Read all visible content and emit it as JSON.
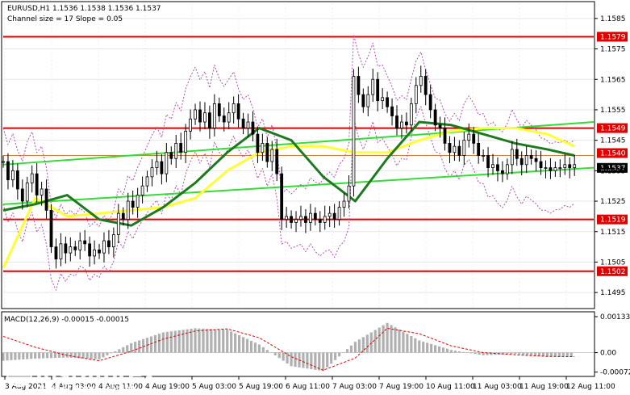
{
  "header": {
    "symbol_line": "EURUSD,H1  1.1536 1.1538 1.1536 1.1537",
    "channel_line": "Channel size = 17 Slope = 0.05",
    "macd_label": "MACD(12,26,9) -0.00015 -0.00015"
  },
  "logo": {
    "name": "instaforex",
    "tagline": "Instant Forex Trading"
  },
  "colors": {
    "candle": "#000000",
    "ma_fast": "#ffff33",
    "ma_slow": "#1e7a1e",
    "channel": "#33dd33",
    "bands": "#b050b0",
    "level_line": "#e00000",
    "macd_hist": "#b0b0b0",
    "macd_signal": "#e00000",
    "tag_current": "#000000",
    "tag_level": "#e00000"
  },
  "chart_data": [
    {
      "type": "line",
      "title": "EURUSD,H1",
      "ylim": [
        1.149,
        1.159
      ],
      "y_ticks": [
        1.1495,
        1.1505,
        1.1515,
        1.1525,
        1.1535,
        1.1545,
        1.1555,
        1.1565,
        1.1575,
        1.1585
      ],
      "x_ticks": [
        "3 Aug 2021",
        "4 Aug 03:00",
        "4 Aug 11:00",
        "4 Aug 19:00",
        "5 Aug 03:00",
        "5 Aug 19:00",
        "6 Aug 11:00",
        "7 Aug 03:00",
        "7 Aug 19:00",
        "10 Aug 11:00",
        "11 Aug 03:00",
        "11 Aug 19:00",
        "12 Aug 11:00"
      ],
      "x_tick_labels": [
        "3 Aug 2021",
        "4 Aug 03:00",
        "4 Aug 11:00",
        "4 Aug 19:00",
        "5 Aug 03:00",
        "5 Aug 19:00",
        "6 Aug 11:00",
        "7 Aug 03:00",
        "7 Aug 19:00",
        "10 Aug 11:00",
        "11 Aug 03:00",
        "11 Aug 19:00",
        "12 Aug 11:00"
      ],
      "horizontal_levels": [
        {
          "label": "1.1579",
          "value": 1.1579
        },
        {
          "label": "1.1549",
          "value": 1.1549
        },
        {
          "label": "1.1519",
          "value": 1.1519
        },
        {
          "label": "1.1502",
          "value": 1.1502
        }
      ],
      "price_tags": [
        {
          "label": "1.1540",
          "value": 1.154,
          "kind": "level"
        },
        {
          "label": "1.1537",
          "value": 1.1537,
          "kind": "current"
        }
      ],
      "series": [
        {
          "name": "EURUSD",
          "x": [
            0,
            6,
            12,
            18,
            24,
            30,
            36,
            42,
            48,
            54,
            60,
            66,
            72,
            78,
            84,
            90,
            96,
            102,
            108,
            114,
            120,
            126,
            132,
            138,
            144,
            150,
            156,
            162,
            168,
            174,
            180,
            186,
            192,
            198,
            204,
            210,
            216,
            222,
            228,
            234,
            240,
            246,
            252,
            258,
            264,
            270,
            276,
            282,
            288,
            294,
            300,
            306,
            312,
            318,
            324,
            330,
            336,
            342,
            348,
            354,
            360,
            366,
            372,
            378,
            384,
            390,
            396,
            402,
            408,
            414,
            420,
            426,
            432,
            438,
            444,
            450,
            456,
            462,
            468,
            474,
            480,
            486,
            492,
            498,
            504,
            510,
            516,
            522,
            528,
            534,
            540,
            546,
            552,
            558,
            564,
            570,
            576,
            582,
            588,
            594,
            600,
            606,
            612,
            618,
            624,
            630,
            636,
            642,
            648,
            654,
            660,
            666,
            672,
            678,
            684,
            690,
            696,
            702,
            708,
            714
          ],
          "values": [
            1.1538,
            1.1532,
            1.1535,
            1.1529,
            1.1525,
            1.1531,
            1.1534,
            1.1527,
            1.1529,
            1.1522,
            1.151,
            1.1506,
            1.1511,
            1.1508,
            1.151,
            1.1509,
            1.1512,
            1.1511,
            1.1507,
            1.1509,
            1.1508,
            1.1512,
            1.151,
            1.1514,
            1.1521,
            1.1519,
            1.1525,
            1.1523,
            1.1527,
            1.153,
            1.1533,
            1.1536,
            1.1538,
            1.1534,
            1.1541,
            1.1539,
            1.1544,
            1.1541,
            1.1548,
            1.1552,
            1.1555,
            1.1551,
            1.1554,
            1.1549,
            1.1557,
            1.1553,
            1.1551,
            1.1554,
            1.1557,
            1.1552,
            1.1549,
            1.1551,
            1.1547,
            1.1541,
            1.1544,
            1.1538,
            1.1542,
            1.1534,
            1.1519,
            1.152,
            1.1518,
            1.1519,
            1.152,
            1.1518,
            1.1521,
            1.1519,
            1.1518,
            1.152,
            1.1521,
            1.1519,
            1.1523,
            1.1525,
            1.153,
            1.1566,
            1.156,
            1.1556,
            1.156,
            1.1565,
            1.1558,
            1.1559,
            1.1556,
            1.1553,
            1.1549,
            1.1551,
            1.155,
            1.1557,
            1.1563,
            1.1566,
            1.156,
            1.1555,
            1.155,
            1.1549,
            1.1544,
            1.1541,
            1.1543,
            1.154,
            1.1545,
            1.1547,
            1.1544,
            1.154,
            1.154,
            1.1536,
            1.1537,
            1.1535,
            1.1534,
            1.1537,
            1.1542,
            1.1539,
            1.1537,
            1.154,
            1.1539,
            1.1538,
            1.1536,
            1.1536,
            1.1535,
            1.1536,
            1.1536,
            1.1537,
            1.1536,
            1.1537
          ]
        },
        {
          "name": "MA fast",
          "x": [
            0,
            40,
            80,
            120,
            160,
            200,
            240,
            280,
            320,
            360,
            400,
            440,
            480,
            520,
            560,
            600,
            640,
            680,
            714
          ],
          "values": [
            1.1503,
            1.1526,
            1.152,
            1.1521,
            1.1522,
            1.1523,
            1.1526,
            1.1535,
            1.1541,
            1.1543,
            1.1543,
            1.1541,
            1.1541,
            1.1545,
            1.1548,
            1.1549,
            1.1549,
            1.1547,
            1.1543
          ]
        },
        {
          "name": "MA slow",
          "x": [
            0,
            40,
            80,
            120,
            160,
            200,
            240,
            280,
            320,
            360,
            400,
            440,
            480,
            520,
            560,
            600,
            640,
            680,
            714
          ],
          "values": [
            1.1522,
            1.1524,
            1.1527,
            1.1519,
            1.1517,
            1.1523,
            1.1531,
            1.1541,
            1.1549,
            1.1545,
            1.1533,
            1.1525,
            1.1539,
            1.1551,
            1.155,
            1.1547,
            1.1544,
            1.1542,
            1.154
          ]
        },
        {
          "name": "Channel upper",
          "x": [
            0,
            738
          ],
          "values": [
            1.1537,
            1.1551
          ]
        },
        {
          "name": "Channel lower",
          "x": [
            0,
            738
          ],
          "values": [
            1.1524,
            1.1536
          ]
        }
      ]
    },
    {
      "type": "bar",
      "title": "MACD(12,26,9) -0.00015 -0.00015",
      "ylim": [
        -0.00085,
        0.00145
      ],
      "y_ticks": [
        0.00133,
        0.0,
        -0.00072
      ],
      "y_tick_labels": [
        "0.00133",
        "0.00",
        "-0.00072"
      ],
      "x": [
        0,
        40,
        80,
        120,
        160,
        200,
        240,
        280,
        320,
        360,
        400,
        440,
        480,
        520,
        560,
        600,
        640,
        680,
        714
      ],
      "values": [
        -0.0003,
        -0.00022,
        -0.00018,
        -0.00025,
        0.00035,
        0.00075,
        0.0009,
        0.00085,
        0.0003,
        -0.0005,
        -0.00068,
        0.0004,
        0.0011,
        0.00045,
        0.0001,
        -0.0001,
        -5e-05,
        -0.00015,
        -0.00015
      ],
      "signal": [
        0.0006,
        0.0002,
        -0.0001,
        -0.0003,
        5e-05,
        0.0005,
        0.0008,
        0.00088,
        0.00055,
        -0.00015,
        -0.00065,
        -0.0002,
        0.0009,
        0.0007,
        0.00025,
        0.0,
        -8e-05,
        -0.00014,
        -0.00015
      ]
    }
  ]
}
